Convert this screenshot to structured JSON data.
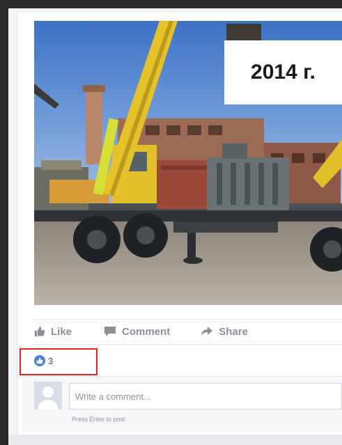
{
  "photo": {
    "caption": "2014 г."
  },
  "actions": {
    "like": "Like",
    "comment": "Comment",
    "share": "Share"
  },
  "reactions": {
    "count": "3"
  },
  "comment_box": {
    "placeholder": "Write a comment...",
    "hint": "Press Enter to post."
  },
  "colors": {
    "accent": "#4a7fd4",
    "highlight_border": "#d9271c",
    "action_text": "#8b8f96"
  },
  "icons": {
    "like": "thumbs-up-icon",
    "comment": "speech-bubble-icon",
    "share": "share-arrow-icon",
    "reaction": "like-reaction-icon",
    "avatar": "default-avatar-icon"
  }
}
